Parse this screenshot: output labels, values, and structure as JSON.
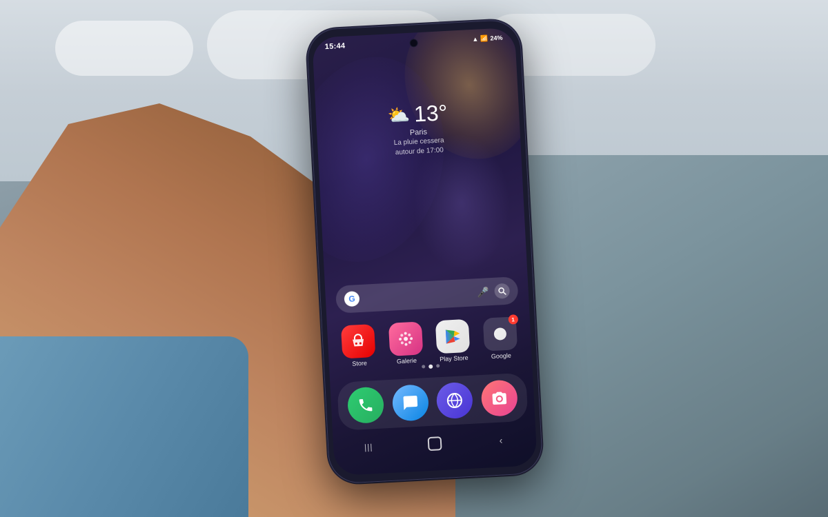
{
  "background": {
    "sky_color": "#d0d8df",
    "buildings_left_color": "#8d9ea8",
    "buildings_right_color": "#8fa3ad"
  },
  "phone": {
    "status_bar": {
      "time": "15:44",
      "battery_percent": "24%",
      "signal_icon": "📶",
      "battery_icon": "🔋",
      "wifi_icon": "📡"
    },
    "weather_widget": {
      "icon": "⛅",
      "temperature": "13°",
      "city": "Paris",
      "description_line1": "La pluie cessera",
      "description_line2": "autour de 17:00"
    },
    "search_bar": {
      "google_letter": "G",
      "mic_icon": "🎤",
      "lens_icon": "🔍"
    },
    "app_row": {
      "apps": [
        {
          "id": "store",
          "label": "Store",
          "icon_type": "store"
        },
        {
          "id": "galerie",
          "label": "Galerie",
          "icon_type": "galerie"
        },
        {
          "id": "play-store",
          "label": "Play Store",
          "icon_type": "playstore"
        },
        {
          "id": "google",
          "label": "Google",
          "icon_type": "google",
          "badge": "1"
        }
      ]
    },
    "page_dots": [
      {
        "active": false
      },
      {
        "active": true
      },
      {
        "active": false
      }
    ],
    "dock": {
      "apps": [
        {
          "id": "phone",
          "icon_type": "phone",
          "label": ""
        },
        {
          "id": "messages",
          "icon_type": "messages",
          "label": ""
        },
        {
          "id": "browser",
          "icon_type": "browser",
          "label": ""
        },
        {
          "id": "camera",
          "icon_type": "camera",
          "label": ""
        }
      ]
    },
    "nav_bar": {
      "recent_icon": "|||",
      "home_icon": "○",
      "back_icon": "<"
    }
  }
}
